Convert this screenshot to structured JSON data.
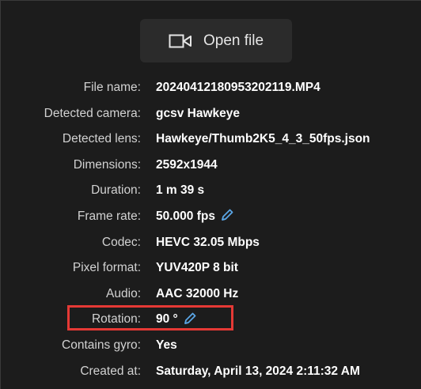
{
  "open_button": {
    "label": "Open file",
    "icon": "video-camera-icon"
  },
  "fields": [
    {
      "label": "File name:",
      "value": "20240412180953202119.MP4"
    },
    {
      "label": "Detected camera:",
      "value": "gcsv Hawkeye"
    },
    {
      "label": "Detected lens:",
      "value": "Hawkeye/Thumb2K5_4_3_50fps.json"
    },
    {
      "label": "Dimensions:",
      "value": "2592x1944"
    },
    {
      "label": "Duration:",
      "value": "1 m 39 s"
    },
    {
      "label": "Frame rate:",
      "value": "50.000 fps",
      "editable": true
    },
    {
      "label": "Codec:",
      "value": "HEVC 32.05 Mbps"
    },
    {
      "label": "Pixel format:",
      "value": "YUV420P 8 bit"
    },
    {
      "label": "Audio:",
      "value": "AAC 32000 Hz"
    },
    {
      "label": "Rotation:",
      "value": "90 °",
      "editable": true
    },
    {
      "label": "Contains gyro:",
      "value": "Yes"
    },
    {
      "label": "Created at:",
      "value": "Saturday, April 13, 2024 2:11:32 AM"
    }
  ],
  "colors": {
    "panel_bg": "#1c1c1c",
    "button_bg": "#2b2b2b",
    "pencil": "#5aa6e6",
    "highlight": "#e53935"
  }
}
